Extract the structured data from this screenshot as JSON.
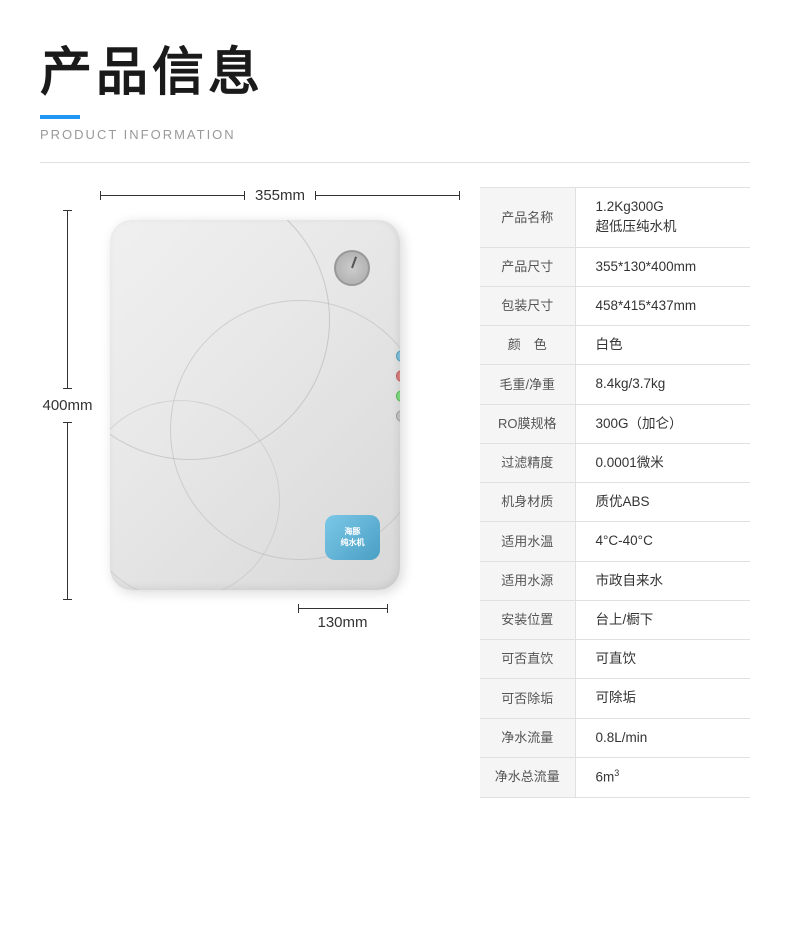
{
  "header": {
    "title": "产品信息",
    "accent_color": "#2196f3",
    "subtitle": "PRODUCT INFORMATION"
  },
  "dimensions": {
    "width_label": "355mm",
    "height_label": "400mm",
    "depth_label": "130mm"
  },
  "specs": [
    {
      "label": "产品名称",
      "value": "1.2Kg300G\n超低压纯水机",
      "multiline": true
    },
    {
      "label": "产品尺寸",
      "value": "355*130*400mm"
    },
    {
      "label": "包装尺寸",
      "value": "458*415*437mm"
    },
    {
      "label": "颜　色",
      "value": "白色"
    },
    {
      "label": "毛重/净重",
      "value": "8.4kg/3.7kg"
    },
    {
      "label": "RO膜规格",
      "value": "300G（加仑）"
    },
    {
      "label": "过滤精度",
      "value": "0.0001微米"
    },
    {
      "label": "机身材质",
      "value": "质优ABS"
    },
    {
      "label": "适用水温",
      "value": "4°C-40°C"
    },
    {
      "label": "适用水源",
      "value": "市政自来水"
    },
    {
      "label": "安装位置",
      "value": "台上/橱下"
    },
    {
      "label": "可否直饮",
      "value": "可直饮"
    },
    {
      "label": "可否除垢",
      "value": "可除垢"
    },
    {
      "label": "净水流量",
      "value": "0.8L/min"
    },
    {
      "label": "净水总流量",
      "value": "6m³",
      "superscript": true
    }
  ],
  "device": {
    "logo_line1": "海豚",
    "logo_line2": "纯水机"
  }
}
